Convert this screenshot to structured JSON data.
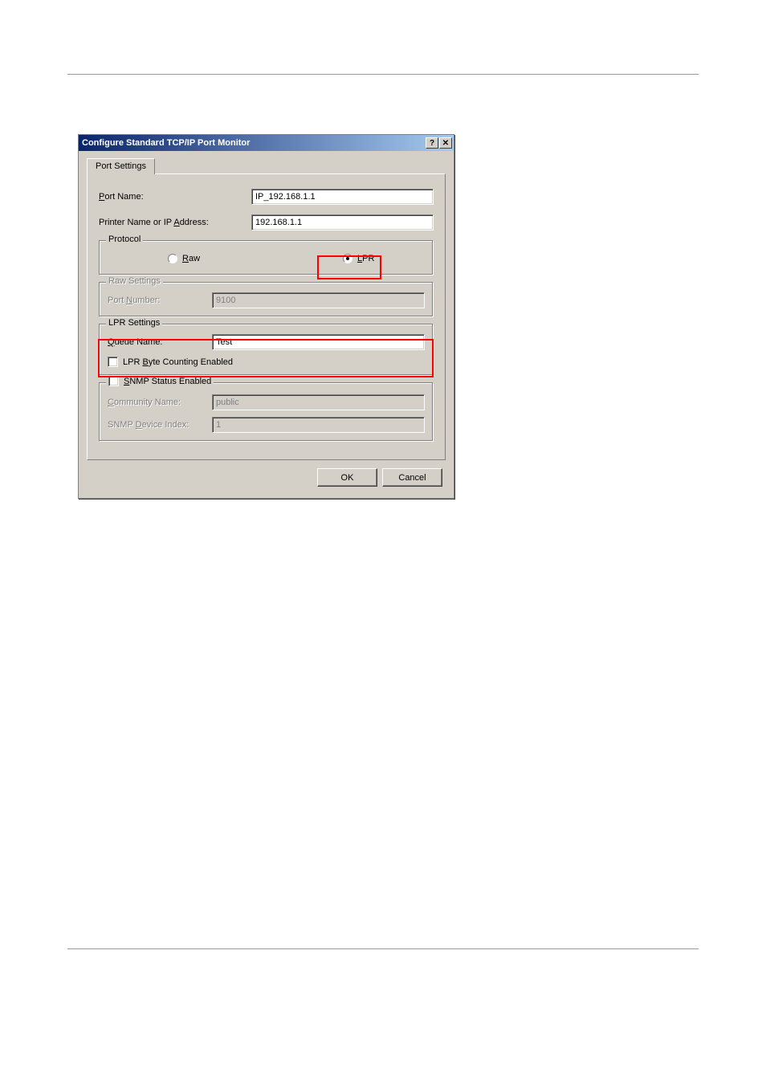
{
  "titlebar": {
    "title": "Configure Standard TCP/IP Port Monitor",
    "help_glyph": "?",
    "close_glyph": "✕"
  },
  "tab": {
    "label": "Port Settings"
  },
  "fields": {
    "port_name_label_pre": "P",
    "port_name_label_post": "ort Name:",
    "port_name_value": "IP_192.168.1.1",
    "printer_label_pre": "Printer Name or IP ",
    "printer_label_mn": "A",
    "printer_label_post": "ddress:",
    "printer_value": "192.168.1.1"
  },
  "protocol": {
    "legend": "Protocol",
    "raw_mn": "R",
    "raw_post": "aw",
    "lpr_mn": "L",
    "lpr_post": "PR"
  },
  "raw_settings": {
    "legend": "Raw Settings",
    "port_number_label_pre": "Port ",
    "port_number_mn": "N",
    "port_number_post": "umber:",
    "port_number_value": "9100"
  },
  "lpr_settings": {
    "legend": "LPR Settings",
    "queue_mn": "Q",
    "queue_post": "ueue Name:",
    "queue_value": "Test",
    "byte_counting_pre": "LPR ",
    "byte_counting_mn": "B",
    "byte_counting_post": "yte Counting Enabled"
  },
  "snmp": {
    "status_mn": "S",
    "status_post": "NMP Status Enabled",
    "community_mn": "C",
    "community_post": "ommunity Name:",
    "community_value": "public",
    "device_pre": "SNMP ",
    "device_mn": "D",
    "device_post": "evice Index:",
    "device_value": "1"
  },
  "buttons": {
    "ok": "OK",
    "cancel": "Cancel"
  }
}
